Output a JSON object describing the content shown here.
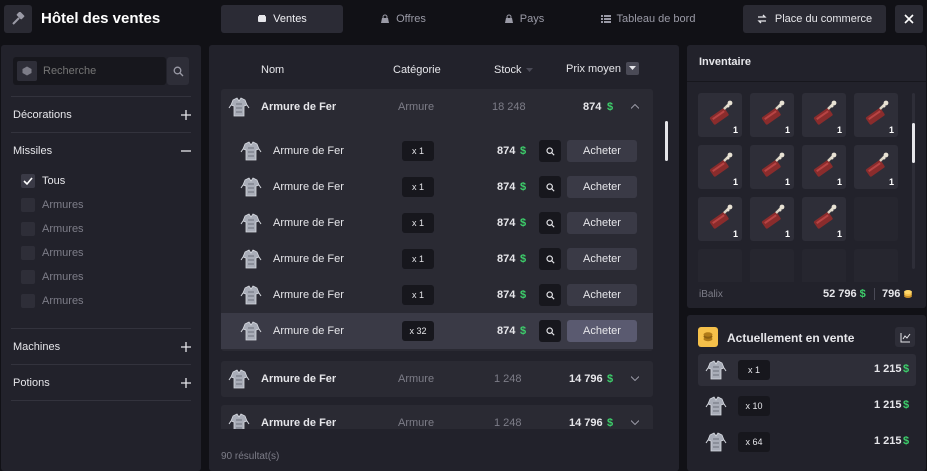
{
  "header": {
    "title": "Hôtel des ventes",
    "tabs": [
      {
        "label": "Ventes",
        "icon": "box-icon",
        "active": true
      },
      {
        "label": "Offres",
        "icon": "bag-icon",
        "active": false
      },
      {
        "label": "Pays",
        "icon": "bag-icon",
        "active": false
      },
      {
        "label": "Tableau de bord",
        "icon": "list-icon",
        "active": false
      }
    ],
    "trade_button": "Place du commerce"
  },
  "sidebar": {
    "search_placeholder": "Recherche",
    "categories": [
      {
        "label": "Décorations",
        "expanded": false
      },
      {
        "label": "Missiles",
        "expanded": true
      },
      {
        "label": "Machines",
        "expanded": false
      },
      {
        "label": "Potions",
        "expanded": false
      }
    ],
    "missile_filters": [
      {
        "label": "Tous",
        "checked": true
      },
      {
        "label": "Armures",
        "checked": false
      },
      {
        "label": "Armures",
        "checked": false
      },
      {
        "label": "Armures",
        "checked": false
      },
      {
        "label": "Armures",
        "checked": false
      },
      {
        "label": "Armures",
        "checked": false
      }
    ]
  },
  "table": {
    "columns": [
      "Nom",
      "Catégorie",
      "Stock",
      "Prix moyen"
    ],
    "groups": [
      {
        "name": "Armure de Fer",
        "category": "Armure",
        "stock": "18 248",
        "price": "874",
        "expanded": true
      },
      {
        "name": "Armure de Fer",
        "category": "Armure",
        "stock": "1 248",
        "price": "14 796",
        "expanded": false
      },
      {
        "name": "Armure de Fer",
        "category": "Armure",
        "stock": "1 248",
        "price": "14 796",
        "expanded": false
      }
    ],
    "offers": [
      {
        "name": "Armure de Fer",
        "qty": "x 1",
        "price": "874",
        "button": "Acheter"
      },
      {
        "name": "Armure de Fer",
        "qty": "x 1",
        "price": "874",
        "button": "Acheter"
      },
      {
        "name": "Armure de Fer",
        "qty": "x 1",
        "price": "874",
        "button": "Acheter"
      },
      {
        "name": "Armure de Fer",
        "qty": "x 1",
        "price": "874",
        "button": "Acheter"
      },
      {
        "name": "Armure de Fer",
        "qty": "x 1",
        "price": "874",
        "button": "Acheter"
      },
      {
        "name": "Armure de Fer",
        "qty": "x 32",
        "price": "874",
        "button": "Acheter"
      }
    ],
    "currency_symbol": "$",
    "results": "90 résultat(s)"
  },
  "inventory": {
    "title": "Inventaire",
    "slots": [
      {
        "count": "1"
      },
      {
        "count": "1"
      },
      {
        "count": "1"
      },
      {
        "count": "1"
      },
      {
        "count": "1"
      },
      {
        "count": "1"
      },
      {
        "count": "1"
      },
      {
        "count": "1"
      },
      {
        "count": "1"
      },
      {
        "count": "1"
      },
      {
        "count": "1"
      }
    ],
    "player": "iBalix",
    "money": "52 796",
    "money_symbol": "$",
    "gold": "796"
  },
  "on_sale": {
    "title": "Actuellement en vente",
    "items": [
      {
        "qty": "x 1",
        "price": "1 215",
        "symbol": "$"
      },
      {
        "qty": "x 10",
        "price": "1 215",
        "symbol": "$"
      },
      {
        "qty": "x 64",
        "price": "1 215",
        "symbol": "$"
      }
    ]
  },
  "colors": {
    "accent_green": "#3dcf6b",
    "gold": "#f5c04a",
    "panel": "#22222b",
    "background": "#111116"
  }
}
